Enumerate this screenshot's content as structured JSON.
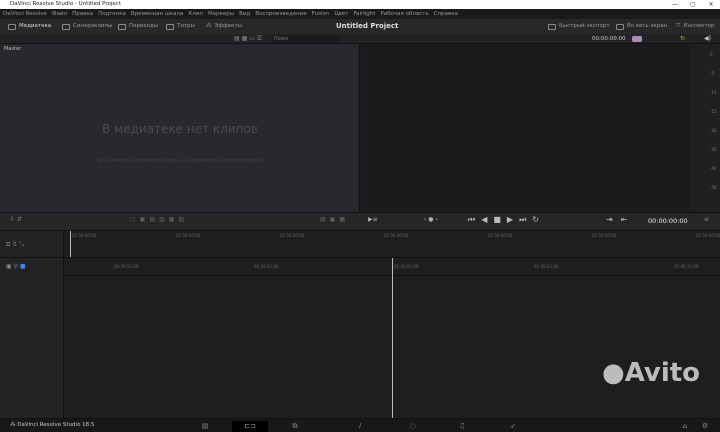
{
  "window": {
    "title": "DaVinci Resolve Studio - Untitled Project",
    "minimize": "—",
    "maximize": "▢",
    "close": "✕"
  },
  "menu": [
    "DaVinci Resolve",
    "Файл",
    "Правка",
    "Подгонка",
    "Временная шкала",
    "Клип",
    "Маркеры",
    "Вид",
    "Воспроизведение",
    "Fusion",
    "Цвет",
    "Fairlight",
    "Рабочая область",
    "Справка"
  ],
  "toolbar": {
    "media": "Медиатека",
    "sync": "Синхроклипы",
    "transitions": "Переходы",
    "titles": "Титры",
    "effects": "Эффекты",
    "project": "Untitled Project",
    "quick_export": "Быстрый экспорт",
    "fullscreen": "Во весь экран",
    "inspector": "Инспектор"
  },
  "subbar": {
    "search_placeholder": "Поиск",
    "timecode": "00:00:00:00"
  },
  "mediapool": {
    "bin": "Master",
    "empty_title": "В медиатеке нет клипов",
    "empty_hint": "Для начала добавьте клипы из хранилища мультимедиа"
  },
  "meter": {
    "labels": [
      "0",
      "-5",
      "-10",
      "-15",
      "-20",
      "-30",
      "-40",
      "-50"
    ]
  },
  "controls": {
    "timecode": "00:00:00:00"
  },
  "timeline": {
    "ruler_top": [
      "01:00:00:00",
      "01:00:10:00",
      "01:00:20:00",
      "01:00:30:00",
      "01:00:40:00",
      "01:00:50:00",
      "01:01:00:00"
    ],
    "ruler_bottom": [
      "00:59:50:00",
      "00:59:55:00",
      "01:00:00:00",
      "01:00:05:00",
      "01:00:10:00"
    ]
  },
  "bottom": {
    "app": "DaVinci Resolve Studio 18.5",
    "watermark": "Avito"
  }
}
